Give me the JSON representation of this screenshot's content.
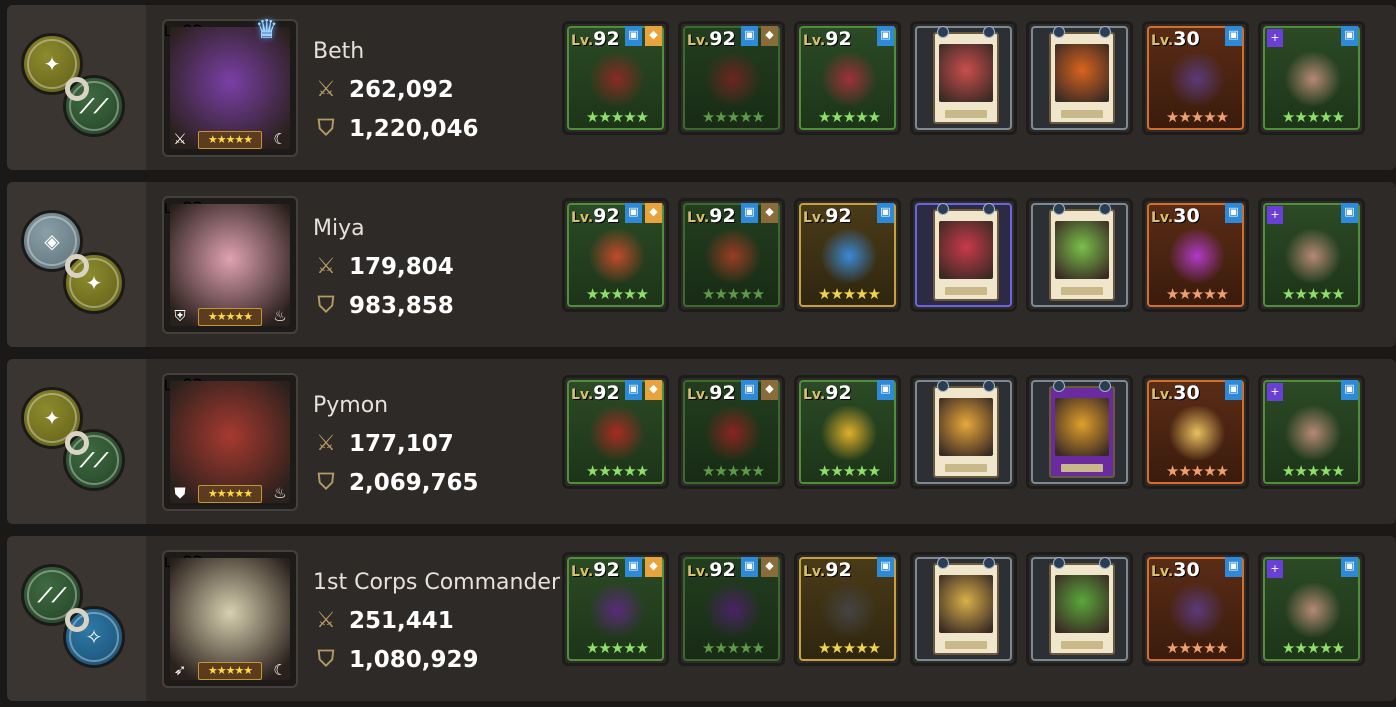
{
  "rows": [
    {
      "level": "92",
      "name": "Beth",
      "attack": "262,092",
      "hp": "1,220,046",
      "has_crown": true,
      "synergy": {
        "a": "olive",
        "b": "green"
      },
      "portrait_color": "#7a3fa6",
      "class_icon": "sword-class-icon",
      "element_icon": "moon-element-icon",
      "items": [
        {
          "type": "weapon",
          "level": "92",
          "stars": 5,
          "color": "green",
          "art": "#8a2a22"
        },
        {
          "type": "weapon",
          "level": "92",
          "stars": 5,
          "color": "green-dim",
          "art": "#6e2520"
        },
        {
          "type": "accessory",
          "level": "92",
          "stars": 5,
          "color": "green",
          "art": "#a0303a"
        },
        {
          "type": "card",
          "art": "#c94e4e"
        },
        {
          "type": "card",
          "art": "#d8641e"
        },
        {
          "type": "merch",
          "level": "30",
          "stars": 5,
          "color": "orange",
          "art": "#5a3a7a"
        },
        {
          "type": "relic",
          "stars": 5,
          "color": "green",
          "art": "#b58a76"
        }
      ]
    },
    {
      "level": "92",
      "name": "Miya",
      "attack": "179,804",
      "hp": "983,858",
      "has_crown": false,
      "synergy": {
        "a": "grey",
        "b": "olive"
      },
      "portrait_color": "#e0a2b0",
      "class_icon": "shield-class-icon",
      "element_icon": "fire-element-icon",
      "items": [
        {
          "type": "weapon",
          "level": "92",
          "stars": 5,
          "color": "green",
          "art": "#c24a2a"
        },
        {
          "type": "weapon",
          "level": "92",
          "stars": 5,
          "color": "green-dim",
          "art": "#9c3c24"
        },
        {
          "type": "accessory",
          "level": "92",
          "stars": 5,
          "color": "yellow",
          "art": "#3a8ad8"
        },
        {
          "type": "card",
          "art": "#c93a4a",
          "frame": "purple"
        },
        {
          "type": "card",
          "art": "#7ac04a"
        },
        {
          "type": "merch",
          "level": "30",
          "stars": 5,
          "color": "orange",
          "art": "#b03ac8"
        },
        {
          "type": "relic",
          "stars": 5,
          "color": "green",
          "art": "#b58a76"
        }
      ]
    },
    {
      "level": "92",
      "name": "Pymon",
      "attack": "177,107",
      "hp": "2,069,765",
      "has_crown": false,
      "synergy": {
        "a": "olive",
        "b": "green"
      },
      "portrait_color": "#a63a30",
      "class_icon": "armor-class-icon",
      "element_icon": "fire-element-icon",
      "items": [
        {
          "type": "weapon",
          "level": "92",
          "stars": 5,
          "color": "green",
          "art": "#a82a22"
        },
        {
          "type": "weapon",
          "level": "92",
          "stars": 5,
          "color": "green-dim",
          "art": "#8a2420"
        },
        {
          "type": "accessory",
          "level": "92",
          "stars": 5,
          "color": "green",
          "art": "#e0b02a"
        },
        {
          "type": "card",
          "art": "#e8a83a"
        },
        {
          "type": "card",
          "art": "#e0a02a",
          "frame": "purple-card"
        },
        {
          "type": "merch",
          "level": "30",
          "stars": 5,
          "color": "orange",
          "art": "#e8c060"
        },
        {
          "type": "relic",
          "stars": 5,
          "color": "green",
          "art": "#b58a76"
        }
      ]
    },
    {
      "level": "92",
      "name": "1st Corps Commander",
      "attack": "251,441",
      "hp": "1,080,929",
      "has_crown": false,
      "synergy": {
        "a": "green",
        "b": "blue"
      },
      "portrait_color": "#d8d0b0",
      "class_icon": "bow-class-icon",
      "element_icon": "moon-element-icon",
      "items": [
        {
          "type": "weapon",
          "level": "92",
          "stars": 5,
          "color": "green",
          "art": "#5a2a7a"
        },
        {
          "type": "weapon",
          "level": "92",
          "stars": 5,
          "color": "green-dim",
          "art": "#4a2266"
        },
        {
          "type": "accessory",
          "level": "92",
          "stars": 5,
          "color": "yellow",
          "art": "#444"
        },
        {
          "type": "card",
          "art": "#d8b04a"
        },
        {
          "type": "card",
          "art": "#5aa83a"
        },
        {
          "type": "merch",
          "level": "30",
          "stars": 5,
          "color": "orange",
          "art": "#5a3a7a"
        },
        {
          "type": "relic",
          "stars": 5,
          "color": "green",
          "art": "#b58a76"
        }
      ]
    }
  ],
  "labels": {
    "lv": "Lv.",
    "star_glyph": "★",
    "crown_glyph": "♛"
  }
}
